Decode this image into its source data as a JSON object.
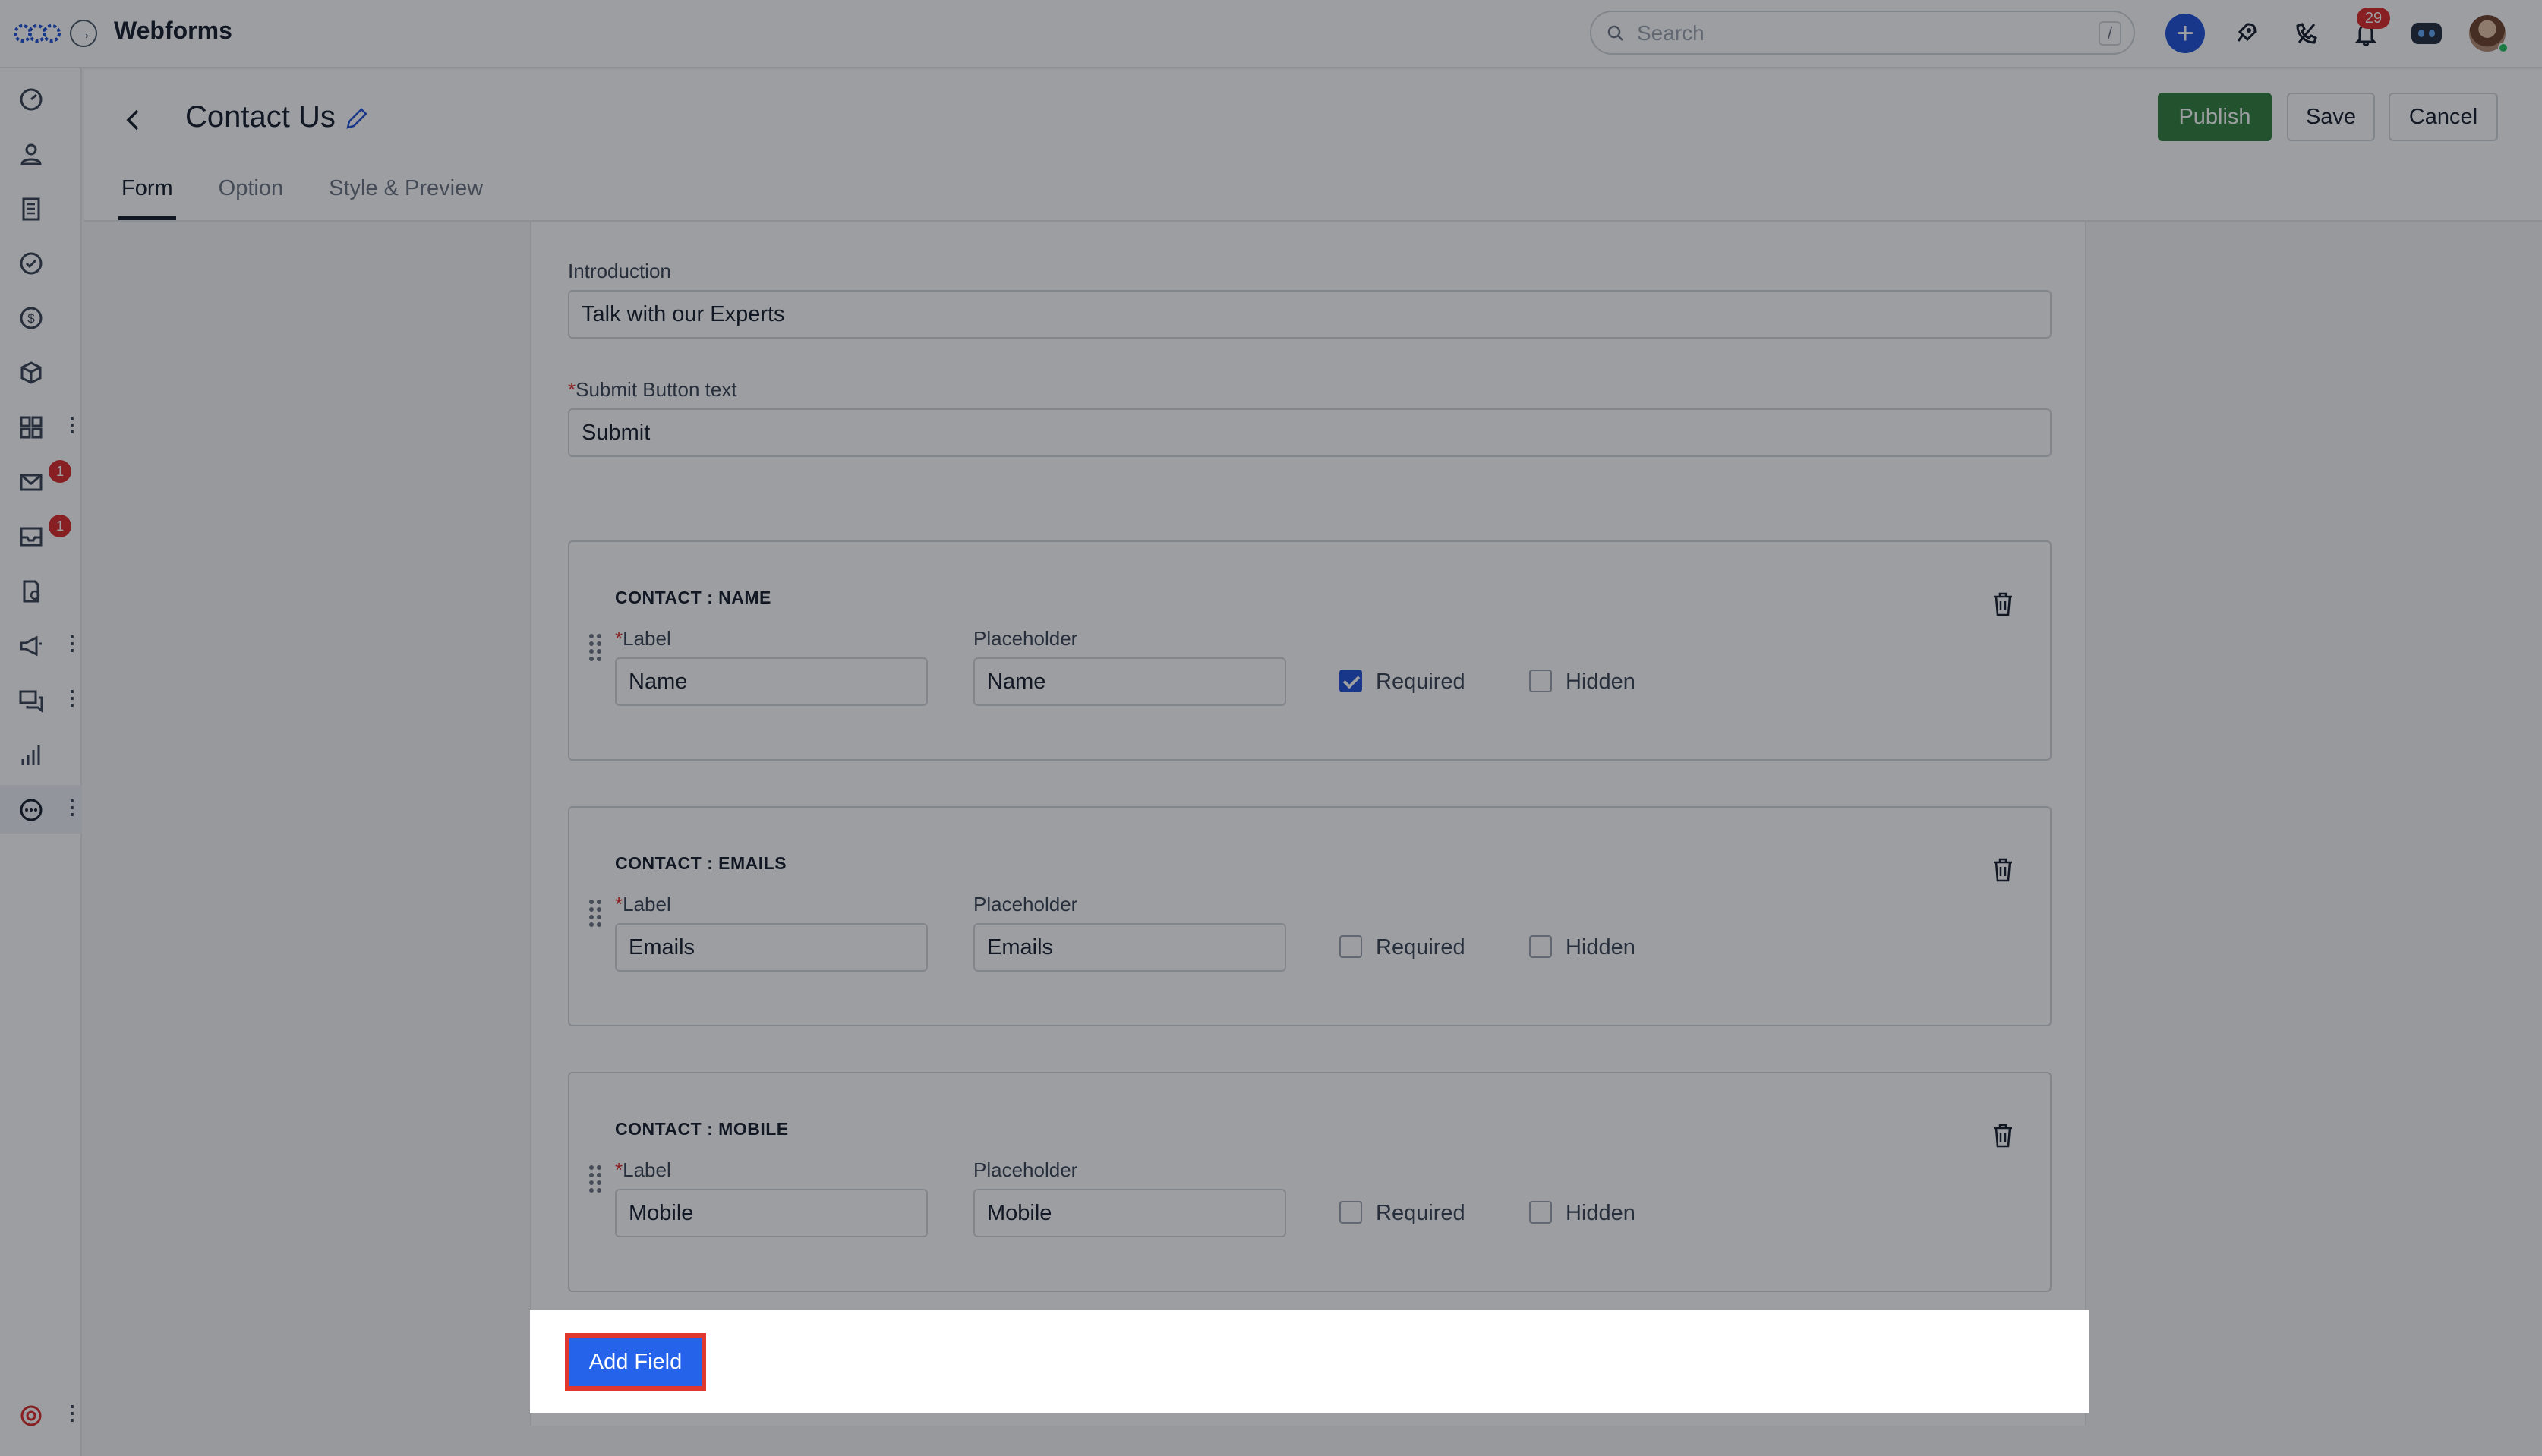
{
  "app": {
    "title": "Webforms",
    "search_placeholder": "Search",
    "search_shortcut": "/",
    "notification_count": "29"
  },
  "sidebar": {
    "items": [
      {
        "icon": "dashboard-icon"
      },
      {
        "icon": "contacts-icon"
      },
      {
        "icon": "companies-icon"
      },
      {
        "icon": "tasks-icon"
      },
      {
        "icon": "deals-icon"
      },
      {
        "icon": "products-icon"
      },
      {
        "icon": "apps-icon"
      },
      {
        "icon": "mail-icon",
        "badge": "1"
      },
      {
        "icon": "inbox-icon",
        "badge": "1"
      },
      {
        "icon": "documents-icon"
      },
      {
        "icon": "campaigns-icon"
      },
      {
        "icon": "conversations-icon"
      },
      {
        "icon": "reports-icon"
      },
      {
        "icon": "more-icon",
        "active": true
      },
      {
        "icon": "help-icon"
      }
    ]
  },
  "header": {
    "form_title": "Contact Us",
    "publish_label": "Publish",
    "save_label": "Save",
    "cancel_label": "Cancel",
    "tabs": [
      {
        "label": "Form",
        "active": true
      },
      {
        "label": "Option",
        "active": false
      },
      {
        "label": "Style & Preview",
        "active": false
      }
    ]
  },
  "form": {
    "introduction_label": "Introduction",
    "introduction_value": "Talk with our Experts",
    "submit_label_star": "*",
    "submit_label": "Submit Button text",
    "submit_value": "Submit",
    "fields": [
      {
        "title": "CONTACT : NAME",
        "label_caption": "Label",
        "label_value": "Name",
        "placeholder_caption": "Placeholder",
        "placeholder_value": "Name",
        "required_label": "Required",
        "required": true,
        "hidden_label": "Hidden",
        "hidden": false
      },
      {
        "title": "CONTACT : EMAILS",
        "label_caption": "Label",
        "label_value": "Emails",
        "placeholder_caption": "Placeholder",
        "placeholder_value": "Emails",
        "required_label": "Required",
        "required": false,
        "hidden_label": "Hidden",
        "hidden": false
      },
      {
        "title": "CONTACT : MOBILE",
        "label_caption": "Label",
        "label_value": "Mobile",
        "placeholder_caption": "Placeholder",
        "placeholder_value": "Mobile",
        "required_label": "Required",
        "required": false,
        "hidden_label": "Hidden",
        "hidden": false
      }
    ],
    "add_field_label": "Add Field"
  },
  "colors": {
    "primary": "#2563eb",
    "publish": "#2f7d3a",
    "highlight": "#e0382f",
    "badge": "#dc2626"
  }
}
